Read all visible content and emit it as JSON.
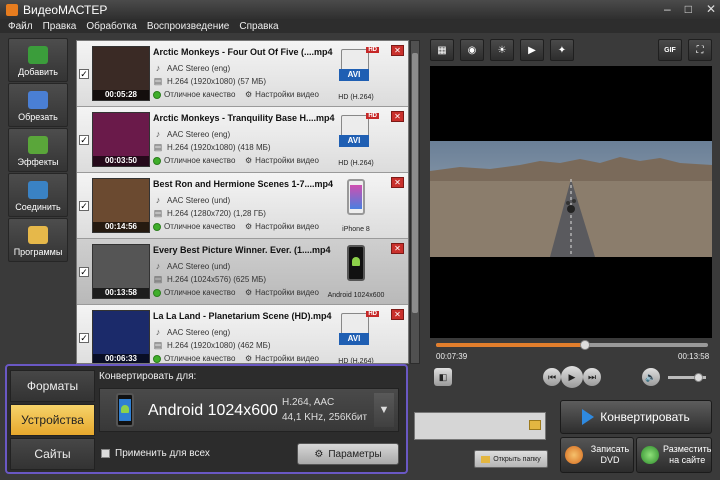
{
  "app": {
    "title": "ВидеоМАСТЕР"
  },
  "window_buttons": {
    "minimize": "–",
    "maximize": "□",
    "close": "✕"
  },
  "menu": [
    "Файл",
    "Правка",
    "Обработка",
    "Воспроизведение",
    "Справка"
  ],
  "sidebar": [
    {
      "label": "Добавить",
      "icon": "add-icon",
      "color": "#3b9d3b"
    },
    {
      "label": "Обрезать",
      "icon": "scissors-icon",
      "color": "#4a7fd4"
    },
    {
      "label": "Эффекты",
      "icon": "effects-icon",
      "color": "#5aa63a"
    },
    {
      "label": "Соединить",
      "icon": "join-icon",
      "color": "#3a82c4"
    },
    {
      "label": "Программы",
      "icon": "programs-icon",
      "color": "#e6b84a"
    }
  ],
  "files": [
    {
      "name": "Arctic Monkeys - Four Out Of Five (....mp4",
      "audio": "AAC Stereo (eng)",
      "video": "H.264 (1920x1080) (57 МБ)",
      "duration": "00:05:28",
      "quality": "Отличное качество",
      "settings": "Настройки видео",
      "format": "AVI",
      "format_label": "HD (H.264)",
      "device": "avi",
      "thumb": "#3a2a25",
      "checked": "✓",
      "selected": false
    },
    {
      "name": "Arctic Monkeys - Tranquility Base H....mp4",
      "audio": "AAC Stereo (eng)",
      "video": "H.264 (1920x1080) (418 МБ)",
      "duration": "00:03:50",
      "quality": "Отличное качество",
      "settings": "Настройки видео",
      "format": "AVI",
      "format_label": "HD (H.264)",
      "device": "avi",
      "thumb": "#6a1a4a",
      "checked": "✓",
      "selected": false
    },
    {
      "name": "Best Ron and Hermione Scenes 1-7....mp4",
      "audio": "AAC Stereo (und)",
      "video": "H.264 (1280x720) (1,28 ГБ)",
      "duration": "00:14:56",
      "quality": "Отличное качество",
      "settings": "Настройки видео",
      "format": "",
      "format_label": "iPhone 8",
      "device": "iphone",
      "thumb": "#6b4a30",
      "checked": "✓",
      "selected": false
    },
    {
      "name": "Every Best Picture Winner. Ever. (1....mp4",
      "audio": "AAC Stereo (und)",
      "video": "H.264 (1024x576) (625 МБ)",
      "duration": "00:13:58",
      "quality": "Отличное качество",
      "settings": "Настройки видео",
      "format": "",
      "format_label": "Android 1024x600",
      "device": "android",
      "thumb": "#555555",
      "checked": "✓",
      "selected": true
    },
    {
      "name": "La La Land - Planetarium Scene (HD).mp4",
      "audio": "AAC Stereo (eng)",
      "video": "H.264 (1920x1080) (462 МБ)",
      "duration": "00:06:33",
      "quality": "Отличное качество",
      "settings": "Настройки видео",
      "format": "AVI",
      "format_label": "HD (H.264)",
      "device": "avi",
      "thumb": "#1b2a6a",
      "checked": "✓",
      "selected": false
    }
  ],
  "hd_badge": "HD",
  "delete_glyph": "✕",
  "toolbar_right": [
    {
      "name": "crop-icon",
      "glyph": "▦"
    },
    {
      "name": "stabilize-icon",
      "glyph": "◉"
    },
    {
      "name": "brightness-icon",
      "glyph": "☀"
    },
    {
      "name": "speed-icon",
      "glyph": "▶"
    },
    {
      "name": "motion-icon",
      "glyph": "✦"
    }
  ],
  "toolbar_extra": {
    "gif": "GIF",
    "fullscreen": "⛶"
  },
  "player": {
    "current_time": "00:07:39",
    "total_time": "00:13:58",
    "progress": 0.548,
    "volume": 0.8,
    "snapshot_glyph": "◧",
    "prev_glyph": "⏮",
    "play_glyph": "▶",
    "next_glyph": "⏭",
    "volume_glyph": "🔈"
  },
  "convert_panel": {
    "tabs": [
      "Форматы",
      "Устройства",
      "Сайты"
    ],
    "active_tab": 1,
    "label": "Конвертировать для:",
    "device_name": "Android 1024x600",
    "spec_line1": "H.264, AAC",
    "spec_line2": "44,1 KHz, 256Кбит",
    "dropdown_glyph": "▼",
    "apply_all": "Применить для всех",
    "params_button": "Параметры",
    "params_glyph": "⚙"
  },
  "actions": {
    "open_folder": "Открыть папку",
    "convert": "Конвертировать",
    "burn_dvd": "Записать DVD",
    "publish": "Разместить на сайте"
  },
  "colors": {
    "accent": "#e27e2c",
    "selection_border": "#6a58c4",
    "active_tab": "#f0c24e"
  }
}
